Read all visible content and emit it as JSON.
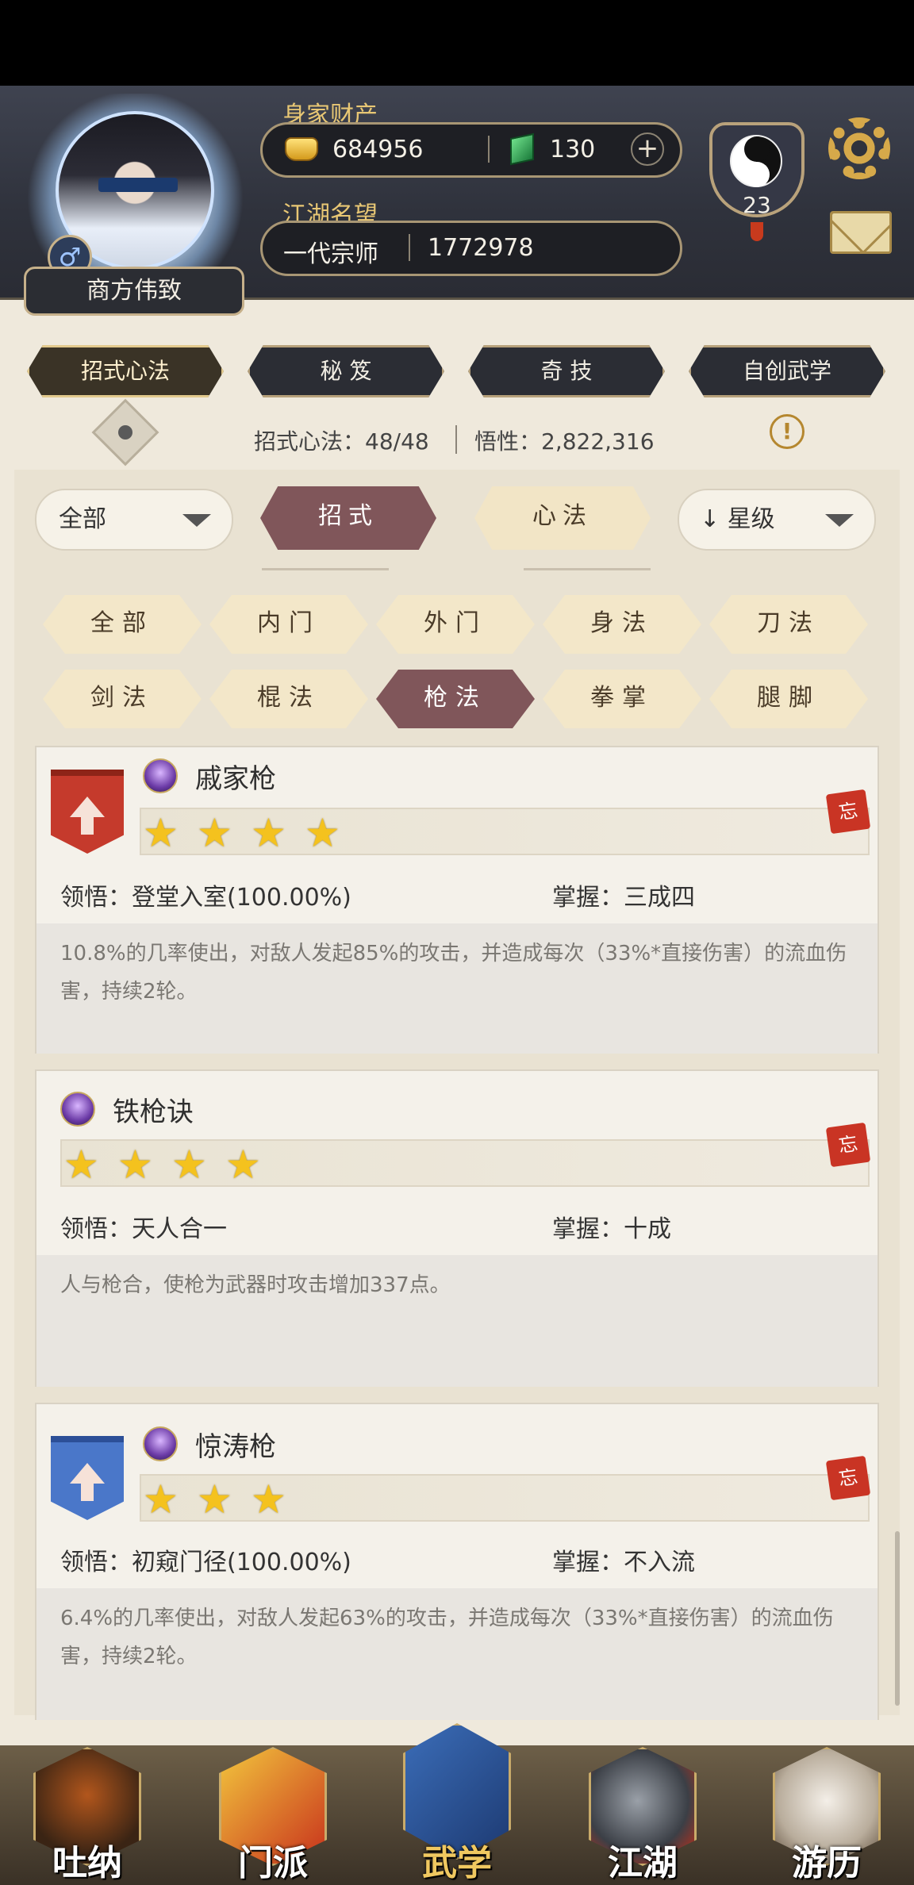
{
  "header": {
    "player_name": "商方伟致",
    "gender_symbol": "♂",
    "wealth_label": "身家财产",
    "gold": "684956",
    "jade": "130",
    "reputation_label": "江湖名望",
    "reputation_title": "一代宗师",
    "reputation_value": "1772978",
    "level": "23"
  },
  "category_tabs": [
    {
      "label": "招式心法",
      "active": true
    },
    {
      "label": "秘 笈",
      "active": false
    },
    {
      "label": "奇 技",
      "active": false
    },
    {
      "label": "自创武学",
      "active": false
    }
  ],
  "stats": {
    "moves": "招式心法：48/48",
    "insight": "悟性：2,822,316"
  },
  "filters": {
    "scope_dropdown": "全部",
    "seg_moves": "招式",
    "seg_mind": "心法",
    "sort_dropdown": "星级",
    "chips": [
      "全部",
      "内门",
      "外门",
      "身法",
      "刀法",
      "剑法",
      "棍法",
      "枪法",
      "拳掌",
      "腿脚"
    ],
    "active_chip": "枪法"
  },
  "skills": [
    {
      "name": "戚家枪",
      "stars": 4,
      "badge": "red",
      "comprehension": "领悟：登堂入室(100.00%)",
      "mastery": "掌握：三成四",
      "description": "10.8%的几率使出，对敌人发起85%的攻击，并造成每次（33%*直接伤害）的流血伤害，持续2轮。"
    },
    {
      "name": "铁枪诀",
      "stars": 4,
      "badge": "",
      "comprehension": "领悟：天人合一",
      "mastery": "掌握：十成",
      "description": "人与枪合，使枪为武器时攻击增加337点。"
    },
    {
      "name": "惊涛枪",
      "stars": 3,
      "badge": "blue",
      "comprehension": "领悟：初窥门径(100.00%)",
      "mastery": "掌握：不入流",
      "description": "6.4%的几率使出，对敌人发起63%的攻击，并造成每次（33%*直接伤害）的流血伤害，持续2轮。"
    }
  ],
  "forget_label": "忘",
  "nav": [
    {
      "label": "吐纳",
      "active": false
    },
    {
      "label": "门派",
      "active": false
    },
    {
      "label": "武学",
      "active": true
    },
    {
      "label": "江湖",
      "active": false
    },
    {
      "label": "游历",
      "active": false
    }
  ],
  "colors": {
    "active_chip": "#80565a",
    "star": "#f4c21e",
    "gold_label": "#e8c774"
  }
}
